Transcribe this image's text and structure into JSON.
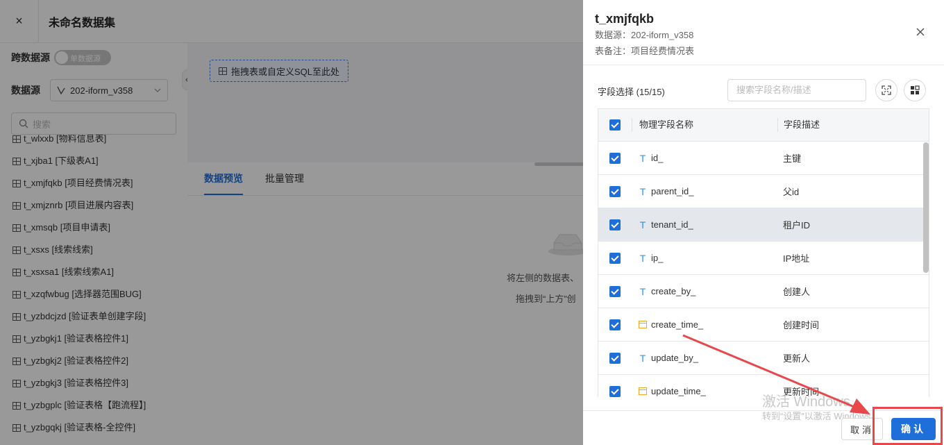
{
  "header": {
    "title": "未命名数据集",
    "close_icon": "×"
  },
  "sidebar": {
    "cross_source_label": "跨数据源",
    "toggle_label": "单数据源",
    "datasource_label": "数据源",
    "datasource_value": "202-iform_v358",
    "search_placeholder": "搜索",
    "tables": [
      "t_wlxxb [物料信息表]",
      "t_xjba1 [下级表A1]",
      "t_xmjfqkb [项目经费情况表]",
      "t_xmjznrb [项目进展内容表]",
      "t_xmsqb [项目申请表]",
      "t_xsxs [线索线索]",
      "t_xsxsa1 [线索线索A1]",
      "t_xzqfwbug [选择器范围BUG]",
      "t_yzbdcjzd [验证表单创建字段]",
      "t_yzbgkj1 [验证表格控件1]",
      "t_yzbgkj2 [验证表格控件2]",
      "t_yzbgkj3 [验证表格控件3]",
      "t_yzbgplc [验证表格【跑流程】]",
      "t_yzbgqkj [验证表格-全控件]"
    ]
  },
  "canvas": {
    "drop_hint": "拖拽表或自定义SQL至此处"
  },
  "tabs": [
    {
      "label": "数据预览"
    },
    {
      "label": "批量管理"
    }
  ],
  "empty": {
    "line1": "将左侧的数据表、",
    "line2": "拖拽到“上方”创"
  },
  "drawer": {
    "title": "t_xmjfqkb",
    "datasource_line": "数据源：202-iform_v358",
    "remark_line": "表备注：项目经费情况表",
    "field_select_label": "字段选择 (15/15)",
    "search_placeholder": "搜索字段名称/描述",
    "columns": {
      "name": "物理字段名称",
      "desc": "字段描述"
    },
    "fields": [
      {
        "name": "id_",
        "desc": "主键",
        "type": "text"
      },
      {
        "name": "parent_id_",
        "desc": "父id",
        "type": "text"
      },
      {
        "name": "tenant_id_",
        "desc": "租户ID",
        "type": "text"
      },
      {
        "name": "ip_",
        "desc": "IP地址",
        "type": "text"
      },
      {
        "name": "create_by_",
        "desc": "创建人",
        "type": "text"
      },
      {
        "name": "create_time_",
        "desc": "创建时间",
        "type": "date"
      },
      {
        "name": "update_by_",
        "desc": "更新人",
        "type": "text"
      },
      {
        "name": "update_time_",
        "desc": "更新时间",
        "type": "date"
      }
    ],
    "cancel_label": "取消",
    "ok_label": "确认"
  },
  "watermark": {
    "line1": "激活 Windows",
    "line2": "转到“设置”以激活 Windows。"
  },
  "colors": {
    "accent": "#1e6fd9",
    "highlight_row": "#e4e7ec",
    "annotation": "#e8484c"
  }
}
